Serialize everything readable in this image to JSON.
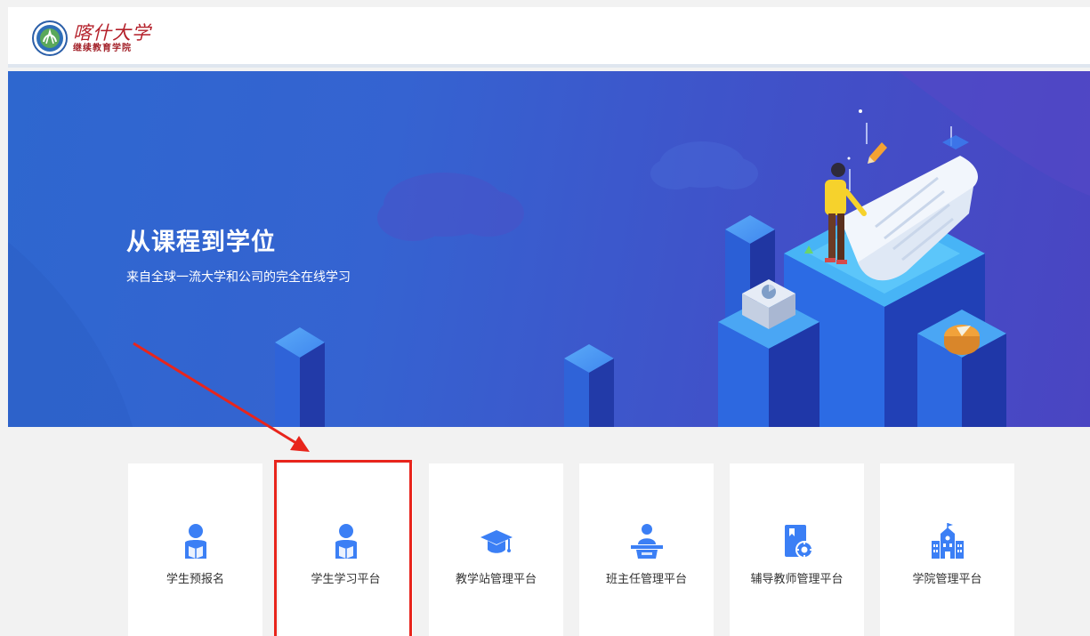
{
  "header": {
    "logo_title": "喀什大学",
    "logo_subtitle": "继续教育学院",
    "logo_icon": "university-seal"
  },
  "banner": {
    "title": "从课程到学位",
    "subtitle": "来自全球一流大学和公司的完全在线学习"
  },
  "cards": [
    {
      "label": "学生预报名",
      "icon": "student-reading-icon"
    },
    {
      "label": "学生学习平台",
      "icon": "student-reading-icon"
    },
    {
      "label": "教学站管理平台",
      "icon": "graduation-cap-icon"
    },
    {
      "label": "班主任管理平台",
      "icon": "lecturer-podium-icon"
    },
    {
      "label": "辅导教师管理平台",
      "icon": "book-gear-icon"
    },
    {
      "label": "学院管理平台",
      "icon": "building-icon"
    }
  ],
  "colors": {
    "accent": "#3b7ff5",
    "highlight": "#e8251c",
    "banner_start": "#2e67cf",
    "banner_end": "#4a45c2",
    "logo_red": "#b4202a"
  }
}
